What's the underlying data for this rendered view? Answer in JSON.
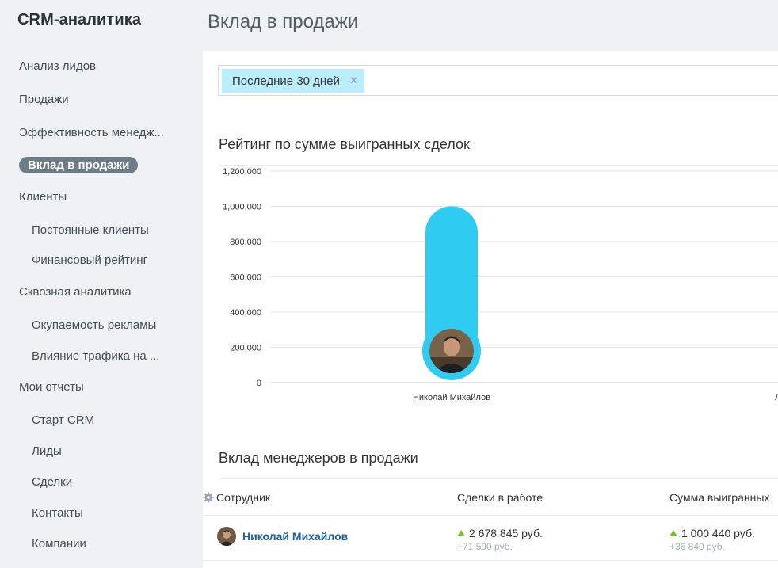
{
  "app": {
    "title": "CRM-аналитика"
  },
  "sidebar": {
    "items": [
      {
        "label": "Анализ лидов"
      },
      {
        "label": "Продажи"
      },
      {
        "label": "Эффективность менедж..."
      },
      {
        "label": "Вклад в продажи",
        "active": true
      },
      {
        "label": "Клиенты"
      },
      {
        "label": "Постоянные клиенты"
      },
      {
        "label": "Финансовый рейтинг"
      },
      {
        "label": "Сквозная аналитика"
      },
      {
        "label": "Окупаемость рекламы"
      },
      {
        "label": "Влияние трафика на ..."
      },
      {
        "label": "Мои отчеты"
      },
      {
        "label": "Старт CRM"
      },
      {
        "label": "Лиды"
      },
      {
        "label": "Сделки"
      },
      {
        "label": "Контакты"
      },
      {
        "label": "Компании"
      }
    ]
  },
  "header": {
    "title": "Вклад в продажи"
  },
  "filter": {
    "tag": "Последние 30 дней",
    "remove_icon": "close-icon"
  },
  "chart_section": {
    "title": "Рейтинг по сумме выигранных сделок"
  },
  "chart_data": {
    "type": "bar",
    "categories": [
      "Николай Михайлов",
      "Л"
    ],
    "values": [
      1000440,
      null
    ],
    "ylim": [
      0,
      1200000
    ],
    "yticks": [
      "0",
      "200,000",
      "400,000",
      "600,000",
      "800,000",
      "1,000,000",
      "1,200,000"
    ],
    "grid": true,
    "bar_color": "#2fcbf0"
  },
  "table_section": {
    "title": "Вклад менеджеров в продажи",
    "columns": [
      "Сотрудник",
      "Сделки в работе",
      "Сумма выигранных"
    ],
    "rows": [
      {
        "name": "Николай Михайлов",
        "deals_in_work": "2 678 845 руб.",
        "deals_in_work_delta": "+71 590 руб.",
        "won_sum": "1 000 440 руб.",
        "won_sum_delta": "+36 840 руб."
      }
    ]
  },
  "colors": {
    "accent": "#2fcbf0",
    "link": "#1f5e9a",
    "positive": "#7bbe2b",
    "tag_bg": "#bcedfc"
  }
}
